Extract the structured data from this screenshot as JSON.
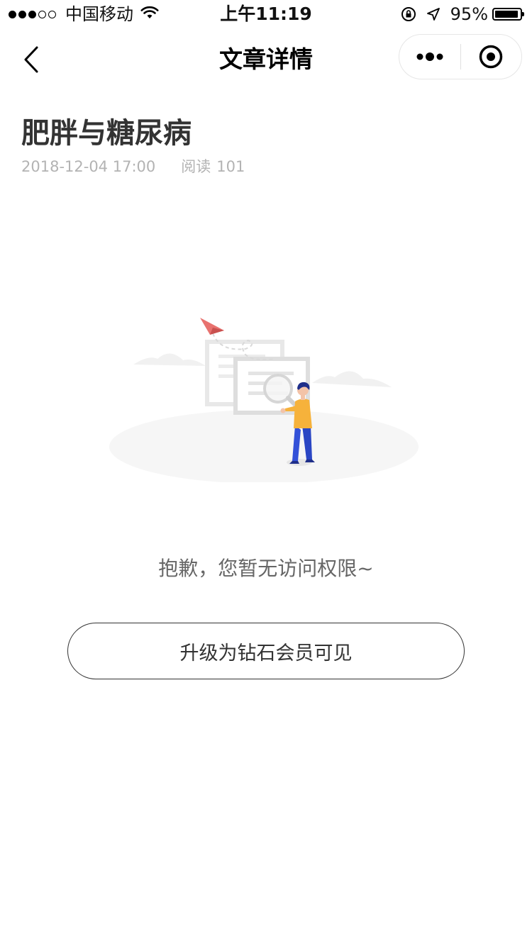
{
  "status_bar": {
    "carrier": "中国移动",
    "time": "上午11:19",
    "battery_percent": "95%",
    "battery_level": 0.95,
    "signal_bars_filled": 3,
    "signal_bars_total": 5
  },
  "nav": {
    "title": "文章详情",
    "back_icon": "chevron-left-icon",
    "more_icon": "more-dots-icon",
    "close_icon": "target-close-icon"
  },
  "article": {
    "title": "肥胖与糖尿病",
    "date": "2018-12-04 17:00",
    "read_label": "阅读",
    "read_count": "101"
  },
  "empty_state": {
    "illustration": "search-no-permission-illustration",
    "message": "抱歉，您暂无访问权限~",
    "button_label": "升级为钻石会员可见"
  },
  "colors": {
    "title": "#333333",
    "meta": "#b3b3b3",
    "message": "#666666",
    "plane": "#e8726f",
    "person_shirt": "#f6b23b",
    "person_pants": "#2d55d6"
  }
}
